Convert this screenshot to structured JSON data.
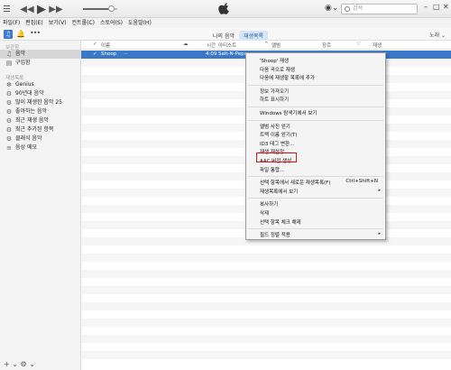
{
  "window": {
    "account_caret": "⌄",
    "search_placeholder": "검색",
    "controls": {
      "minimize": "–",
      "maximize": "□",
      "close": "✕"
    }
  },
  "menubar": [
    "파일(F)",
    "편집(E)",
    "보기(V)",
    "컨트롤(C)",
    "스토어(S)",
    "도움말(H)"
  ],
  "subbar": {
    "tabs": [
      {
        "label": "나의 음악",
        "active": false
      },
      {
        "label": "재생목록",
        "active": true
      }
    ],
    "view_label": "노래 ⌄"
  },
  "sidebar": {
    "library_header": "보관함",
    "library_items": [
      {
        "label": "음악",
        "icon": "music-note-icon",
        "selected": true
      },
      {
        "label": "구입함",
        "icon": "purchased-icon",
        "selected": false
      }
    ],
    "playlists_header": "재생목록",
    "playlist_items": [
      {
        "label": "Genius",
        "icon": "genius-icon"
      },
      {
        "label": "90년대 음악",
        "icon": "smart-playlist-icon"
      },
      {
        "label": "많이 재생한 음악 25",
        "icon": "smart-playlist-icon"
      },
      {
        "label": "좋아하는 음악",
        "icon": "smart-playlist-icon"
      },
      {
        "label": "최근 재생 음악",
        "icon": "smart-playlist-icon"
      },
      {
        "label": "최근 추가된 항목",
        "icon": "smart-playlist-icon"
      },
      {
        "label": "클래식 음악",
        "icon": "smart-playlist-icon"
      },
      {
        "label": "음성 메모",
        "icon": "playlist-icon"
      }
    ],
    "footer": "+ ⌄  ⚙ ⌄"
  },
  "table": {
    "headers": {
      "check": "✓",
      "name": "이름",
      "cloud": "☁",
      "time": "시간",
      "artist": "아티스트",
      "sort_arrow": "^",
      "album": "앨범",
      "genre": "장르",
      "heart": "♡",
      "plays": "재생"
    },
    "rows": [
      {
        "name": "Shoop",
        "time": "4:09",
        "artist": "Salt-N-Pepa",
        "selected": true
      }
    ]
  },
  "context_menu": {
    "items": [
      {
        "label": "'Shoop' 재생"
      },
      {
        "label": "다음 곡으로 재생"
      },
      {
        "label": "다음에 재생할 목록에 추가"
      },
      {
        "sep": true
      },
      {
        "label": "정보 가져오기"
      },
      {
        "label": "하트 표시하기"
      },
      {
        "sep": true
      },
      {
        "label": "Windows 탐색기에서 보기"
      },
      {
        "sep": true
      },
      {
        "label": "앨범 사진 얻기"
      },
      {
        "label": "트랙 이름 얻기(T)"
      },
      {
        "label": "ID3 태그 변환..."
      },
      {
        "label": "재생 재설정"
      },
      {
        "label": "AAC 버전 생성",
        "highlighted": true
      },
      {
        "label": "파일 통합..."
      },
      {
        "sep": true
      },
      {
        "label": "선택 항목에서 새로운 재생목록(F)",
        "shortcut": "Ctrl+Shift+N"
      },
      {
        "label": "재생목록에서 보기",
        "submenu": true
      },
      {
        "sep": true
      },
      {
        "label": "복사하기"
      },
      {
        "label": "삭제"
      },
      {
        "label": "선택 항목 체크 해제"
      },
      {
        "sep": true
      },
      {
        "label": "필드 정렬 적용",
        "submenu": true
      }
    ]
  }
}
